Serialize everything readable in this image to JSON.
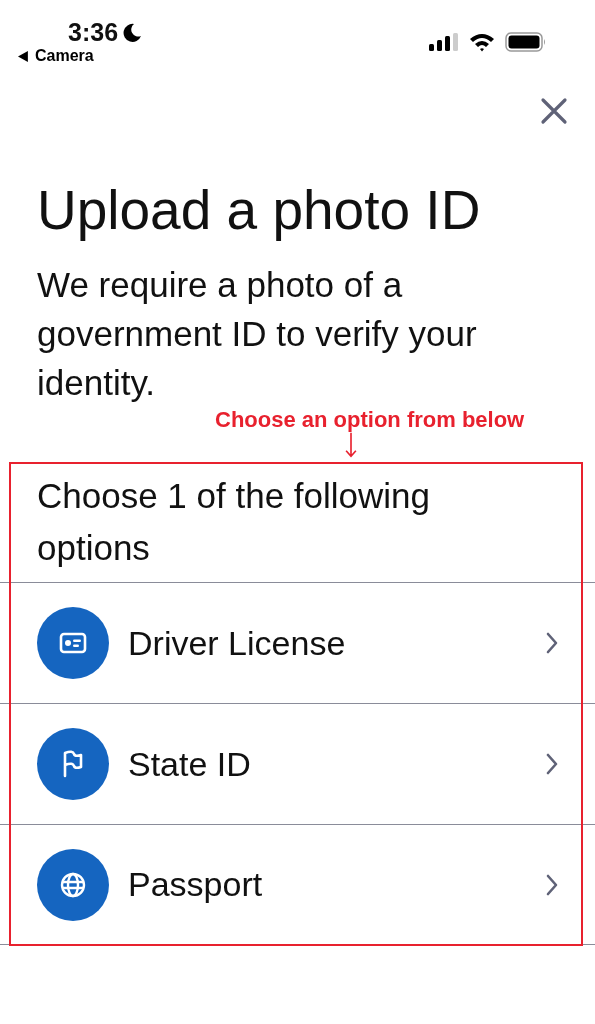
{
  "status_bar": {
    "time": "3:36",
    "do_not_disturb": true,
    "back_label": "Camera"
  },
  "title": "Upload a photo ID",
  "description": "We require a photo of a government ID to verify your identity.",
  "annotation": {
    "text": "Choose an option from below"
  },
  "options_heading": "Choose 1 of the following options",
  "options": [
    {
      "label": "Driver License"
    },
    {
      "label": "State ID"
    },
    {
      "label": "Passport"
    }
  ]
}
